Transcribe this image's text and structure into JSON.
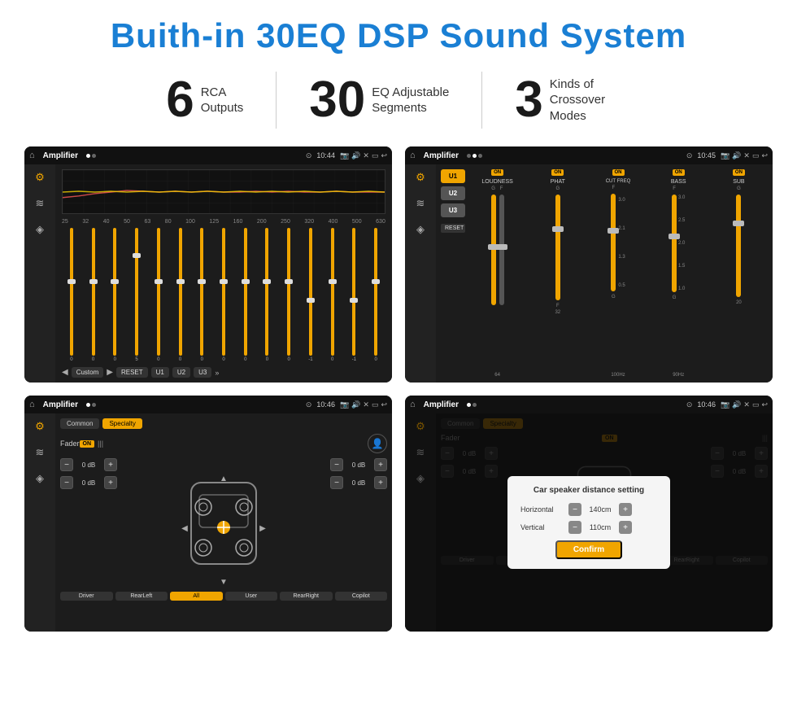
{
  "page": {
    "title": "Buith-in 30EQ DSP Sound System"
  },
  "stats": [
    {
      "number": "6",
      "label_line1": "RCA",
      "label_line2": "Outputs"
    },
    {
      "number": "30",
      "label_line1": "EQ Adjustable",
      "label_line2": "Segments"
    },
    {
      "number": "3",
      "label_line1": "Kinds of",
      "label_line2": "Crossover Modes"
    }
  ],
  "screens": {
    "eq": {
      "title": "Amplifier",
      "time": "10:44",
      "freq_labels": [
        "25",
        "32",
        "40",
        "50",
        "63",
        "80",
        "100",
        "125",
        "160",
        "200",
        "250",
        "320",
        "400",
        "500",
        "630"
      ],
      "slider_vals": [
        "0",
        "0",
        "0",
        "5",
        "0",
        "0",
        "0",
        "0",
        "0",
        "0",
        "0",
        "-1",
        "0",
        "-1"
      ],
      "custom_label": "Custom",
      "buttons": [
        "RESET",
        "U1",
        "U2",
        "U3"
      ]
    },
    "crossover": {
      "title": "Amplifier",
      "time": "10:45",
      "presets": [
        "U1",
        "U2",
        "U3"
      ],
      "channels": [
        {
          "toggle": "ON",
          "name": "LOUDNESS"
        },
        {
          "toggle": "ON",
          "name": "PHAT"
        },
        {
          "toggle": "ON",
          "name": "CUT FREQ"
        },
        {
          "toggle": "ON",
          "name": "BASS"
        },
        {
          "toggle": "ON",
          "name": "SUB"
        }
      ],
      "reset_label": "RESET"
    },
    "fader": {
      "title": "Amplifier",
      "time": "10:46",
      "tabs": [
        "Common",
        "Specialty"
      ],
      "fader_label": "Fader",
      "fader_toggle": "ON",
      "vol_rows": [
        {
          "val": "0 dB"
        },
        {
          "val": "0 dB"
        },
        {
          "val": "0 dB"
        },
        {
          "val": "0 dB"
        }
      ],
      "bottom_btns": [
        "Driver",
        "RearLeft",
        "All",
        "User",
        "RearRight",
        "Copilot"
      ],
      "all_active": true
    },
    "distance": {
      "title": "Amplifier",
      "time": "10:46",
      "tabs": [
        "Common",
        "Specialty"
      ],
      "dialog": {
        "title": "Car speaker distance setting",
        "horizontal_label": "Horizontal",
        "horizontal_val": "140cm",
        "vertical_label": "Vertical",
        "vertical_val": "110cm",
        "confirm_label": "Confirm"
      }
    }
  }
}
